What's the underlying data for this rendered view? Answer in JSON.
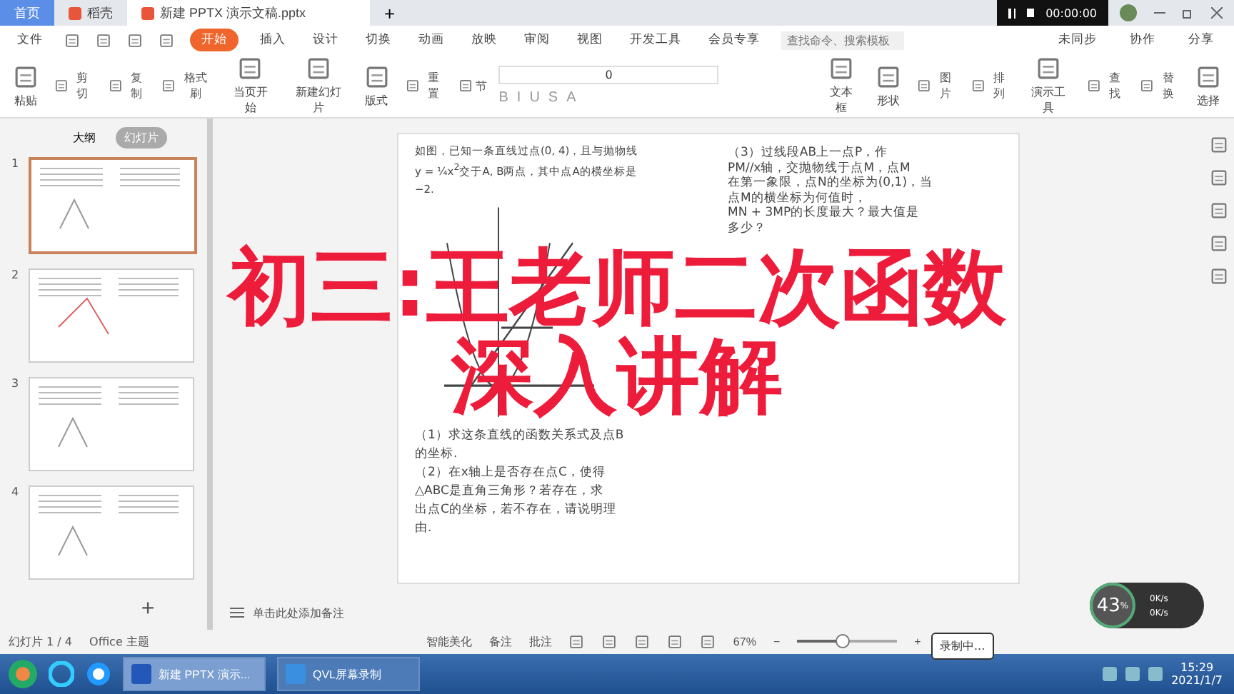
{
  "tabs": [
    {
      "label": "首页",
      "kind": "home",
      "selected": false
    },
    {
      "label": "稻壳",
      "kind": "app",
      "selected": false
    },
    {
      "label": "新建 PPTX 演示文稿.pptx",
      "kind": "doc",
      "selected": true
    }
  ],
  "new_tab": "+",
  "recorder": {
    "time": "00:00:00"
  },
  "menu": {
    "file": "文件",
    "tabs": [
      {
        "label": "开始",
        "selected": true
      },
      {
        "label": "插入",
        "selected": false
      },
      {
        "label": "设计",
        "selected": false
      },
      {
        "label": "切换",
        "selected": false
      },
      {
        "label": "动画",
        "selected": false
      },
      {
        "label": "放映",
        "selected": false
      },
      {
        "label": "审阅",
        "selected": false
      },
      {
        "label": "视图",
        "selected": false
      },
      {
        "label": "开发工具",
        "selected": false
      },
      {
        "label": "会员专享",
        "selected": false
      }
    ],
    "search": {
      "placeholder": "查找命令、搜索模板"
    },
    "actions": [
      "未同步",
      "协作",
      "分享"
    ]
  },
  "ribbon": {
    "left": [
      {
        "label": "粘贴",
        "kind": "big"
      },
      {
        "label": "剪切",
        "kind": "small"
      },
      {
        "label": "复制",
        "kind": "small"
      },
      {
        "label": "格式刷",
        "kind": "small"
      },
      {
        "label": "当页开始",
        "kind": "big"
      },
      {
        "label": "新建幻灯片",
        "kind": "big"
      },
      {
        "label": "版式",
        "kind": "big"
      },
      {
        "label": "重置",
        "kind": "small"
      },
      {
        "label": "节",
        "kind": "small"
      }
    ],
    "font_size": "0",
    "format": [
      "B",
      "I",
      "U",
      "S",
      "A"
    ],
    "right": [
      {
        "label": "文本框",
        "kind": "big"
      },
      {
        "label": "形状",
        "kind": "big"
      },
      {
        "label": "图片",
        "kind": "small"
      },
      {
        "label": "排列",
        "kind": "small"
      },
      {
        "label": "演示工具",
        "kind": "big"
      },
      {
        "label": "查找",
        "kind": "small"
      },
      {
        "label": "替换",
        "kind": "small"
      },
      {
        "label": "选择",
        "kind": "big"
      }
    ]
  },
  "panel": {
    "tabs": [
      {
        "label": "大纲",
        "selected": false
      },
      {
        "label": "幻灯片",
        "selected": true
      }
    ],
    "slides": [
      {
        "number": "1",
        "selected": true
      },
      {
        "number": "2",
        "selected": false
      },
      {
        "number": "3",
        "selected": false
      },
      {
        "number": "4",
        "selected": false
      }
    ],
    "add": "+"
  },
  "slide": {
    "intro": [
      "如图，已知一条直线过点(0, 4)，且与抛物线",
      "y = ¼x$^{2}$交于A, B两点，其中点A的横坐标是",
      "−2."
    ],
    "questions_left": [
      "（1）求这条直线的函数关系式及点B",
      "的坐标.",
      "（2）在x轴上是否存在点C，使得",
      "△ABC是直角三角形？若存在，求",
      "出点C的坐标，若不存在，请说明理",
      "由."
    ],
    "questions_right": [
      "（3）过线段AB上一点P，作",
      "PM//x轴，交抛物线于点M，点M",
      "在第一象限，点N的坐标为(0,1)，当",
      "点M的横坐标为何值时，",
      "MN + 3MP的长度最大？最大值是",
      "多少？"
    ]
  },
  "overlay_title": [
    "初三:王老师二次函数",
    "深入讲解"
  ],
  "notes_placeholder": "单击此处添加备注",
  "status_bar": {
    "slide": "幻灯片 1 / 4",
    "theme": "Office 主题",
    "beautify": "智能美化",
    "notes": "备注",
    "comments": "批注",
    "zoom": "67%",
    "minus": "−",
    "zoom_level": {
      "level": 0.45
    },
    "plus": "+"
  },
  "taskbar": {
    "apps": [
      {
        "label": "新建 PPTX 演示...",
        "selected": true
      },
      {
        "label": "QVL屏幕录制",
        "selected": false
      }
    ],
    "time": "15:29",
    "date": "2021/1/7",
    "tooltip": "录制中..."
  },
  "speed_widget": {
    "percent": "43",
    "unit": "%",
    "up": "0K/s",
    "down": "0K/s"
  }
}
